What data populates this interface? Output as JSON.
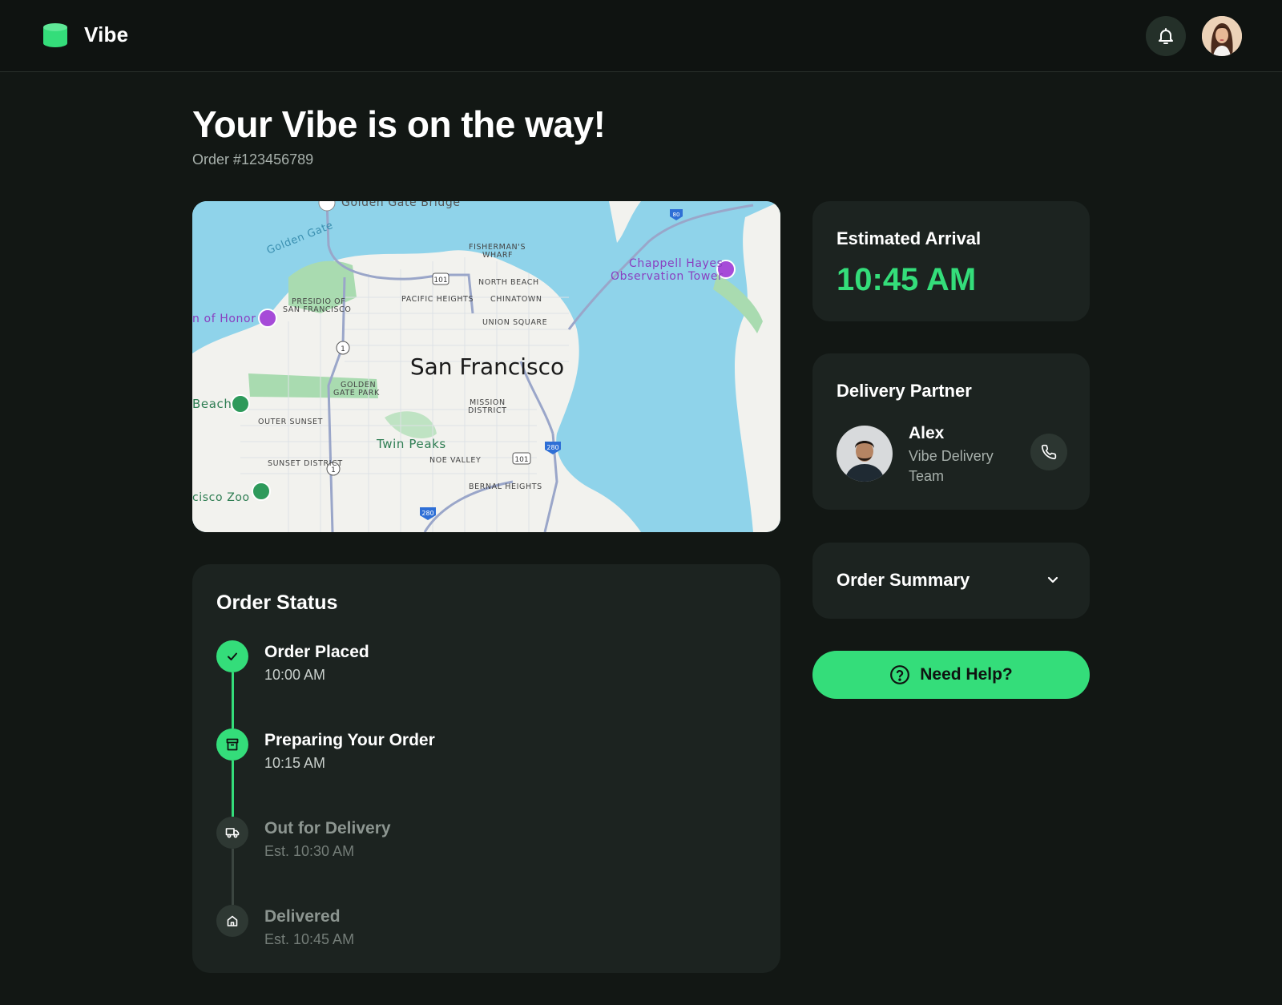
{
  "header": {
    "brand": "Vibe",
    "icons": {
      "logo": "cylinder-logo",
      "notifications": "bell-icon",
      "avatar": "user-avatar"
    }
  },
  "page": {
    "title": "Your Vibe is on the way!",
    "order_number": "Order #123456789"
  },
  "map": {
    "city": "San Francisco",
    "places": {
      "golden_gate_bridge": "Golden Gate Bridge",
      "golden_gate": "Golden Gate",
      "fishermans_wharf_1": "FISHERMAN'S",
      "fishermans_wharf_2": "WHARF",
      "north_beach": "NORTH BEACH",
      "chinatown": "CHINATOWN",
      "pacific_heights": "PACIFIC HEIGHTS",
      "union_square": "UNION SQUARE",
      "presidio_1": "PRESIDIO OF",
      "presidio_2": "SAN FRANCISCO",
      "legion_of_honor": "n of Honor",
      "chappell_1": "Chappell Hayes",
      "chappell_2": "Observation Tower",
      "golden_gate_park_1": "GOLDEN",
      "golden_gate_park_2": "GATE PARK",
      "mission_1": "MISSION",
      "mission_2": "DISTRICT",
      "beach": "Beach",
      "outer_sunset": "OUTER SUNSET",
      "twin_peaks": "Twin Peaks",
      "noe_valley": "NOE VALLEY",
      "sunset_district": "SUNSET DISTRICT",
      "bernal_heights": "BERNAL HEIGHTS",
      "zoo": "cisco Zoo"
    },
    "highway_shields": {
      "us101": "101",
      "ca1": "1",
      "i280": "280",
      "i80": "80"
    }
  },
  "eta": {
    "label": "Estimated Arrival",
    "time": "10:45 AM"
  },
  "partner": {
    "label": "Delivery Partner",
    "name": "Alex",
    "team": "Vibe Delivery Team",
    "call_icon": "phone-icon"
  },
  "summary": {
    "label": "Order Summary",
    "icon": "chevron-down-icon"
  },
  "help": {
    "label": "Need Help?",
    "icon": "question-circle-icon"
  },
  "status": {
    "label": "Order Status",
    "steps": [
      {
        "title": "Order Placed",
        "time": "10:00 AM",
        "state": "done",
        "icon": "check-icon"
      },
      {
        "title": "Preparing Your Order",
        "time": "10:15 AM",
        "state": "done",
        "icon": "box-icon"
      },
      {
        "title": "Out for Delivery",
        "time": "Est. 10:30 AM",
        "state": "pending",
        "icon": "truck-icon"
      },
      {
        "title": "Delivered",
        "time": "Est. 10:45 AM",
        "state": "pending",
        "icon": "home-icon"
      }
    ]
  },
  "colors": {
    "accent": "#34dd7a",
    "background": "#121714",
    "card": "#1c2320",
    "muted_text": "#a7b0ab",
    "water": "#8fd3ea",
    "land": "#f2f2ee",
    "park": "#a9dbb0"
  }
}
